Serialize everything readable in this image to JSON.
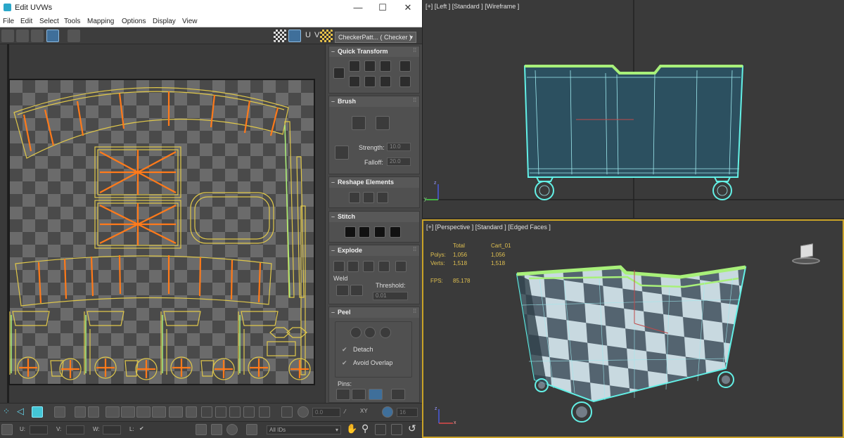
{
  "window": {
    "title": "Edit UVWs",
    "minimize": "—",
    "maximize": "☐",
    "close": "✕"
  },
  "menu": [
    "File",
    "Edit",
    "Select",
    "Tools",
    "Mapping",
    "Options",
    "Display",
    "View"
  ],
  "toolbar": {
    "uv_label": "U V",
    "texture_dropdown": "CheckerPatt... ( Checker )"
  },
  "rollouts": {
    "quick_transform": "Quick Transform",
    "brush": {
      "title": "Brush",
      "strength_label": "Strength:",
      "strength_value": "10.0",
      "falloff_label": "Falloff:",
      "falloff_value": "20.0"
    },
    "reshape": "Reshape Elements",
    "stitch": "Stitch",
    "explode": {
      "title": "Explode",
      "weld_label": "Weld",
      "threshold_label": "Threshold:",
      "threshold_value": "0.01"
    },
    "peel": {
      "title": "Peel",
      "detach": "Detach",
      "avoid_overlap": "Avoid Overlap",
      "pins_label": "Pins:"
    }
  },
  "bottom": {
    "angle_value": "0.0",
    "xy_label": "XY",
    "grid_value": "16",
    "u_label": "U:",
    "v_label": "V:",
    "w_label": "W:",
    "l_label": "L:",
    "ids_dropdown": "All IDs"
  },
  "viewport_left": {
    "label": "[+] [Left ] [Standard ] [Wireframe ]",
    "axis_z": "z",
    "axis_y": "y"
  },
  "viewport_persp": {
    "label": "[+] [Perspective ] [Standard ] [Edged Faces ]",
    "stats": {
      "col_total": "Total",
      "col_obj": "Cart_01",
      "polys_label": "Polys:",
      "polys_total": "1,056",
      "polys_obj": "1,056",
      "verts_label": "Verts:",
      "verts_total": "1,518",
      "verts_obj": "1,518",
      "fps_label": "FPS:",
      "fps_value": "85.178"
    },
    "axis_z": "z",
    "axis_x": "x"
  },
  "colors": {
    "uv_edge": "#e0c84a",
    "uv_seam": "#ff7a1a",
    "selection": "#63f0e6",
    "highlight": "#a8f07a",
    "active_border": "#c9a227"
  }
}
